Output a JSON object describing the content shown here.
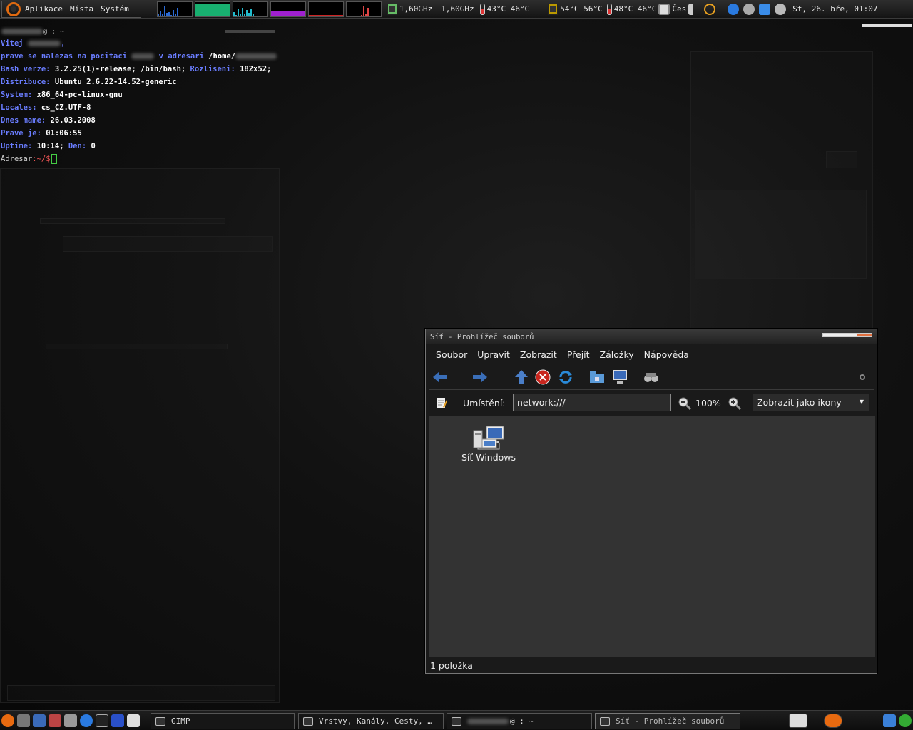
{
  "top_panel": {
    "menus": [
      "Aplikace",
      "Místa",
      "Systém"
    ],
    "cpu1_freq": "1,60GHz",
    "cpu2_freq": "1,60GHz",
    "cpu_temps": "43°C 46°C",
    "hdd_temps": "54°C 56°C",
    "other_temps": "48°C 46°C",
    "keyboard_layout": "Čes",
    "clock": "St, 26. bře, 01:07"
  },
  "terminal": {
    "title": "@ : ~",
    "lines": [
      {
        "label": "Vitej",
        "value": ","
      },
      {
        "label": "prave se nalezas na pocitaci",
        "label2": "v adresari",
        "value": "/home/"
      },
      {
        "label": "Bash verze:",
        "value": "3.2.25(1)-release;",
        "value2": "/bin/bash;",
        "label2": "Rozliseni:",
        "value3": "182x52;"
      },
      {
        "label": "Distribuce:",
        "value": "Ubuntu 2.6.22-14.52-generic"
      },
      {
        "label": "System:",
        "value": "x86_64-pc-linux-gnu"
      },
      {
        "label": "Locales:",
        "value": "cs_CZ.UTF-8"
      },
      {
        "label": "Dnes mame:",
        "value": "26.03.2008"
      },
      {
        "label": "Prave je:",
        "value": "01:06:55"
      },
      {
        "label": "Uptime:",
        "value": "10:14;",
        "label2": "Den:",
        "value2": "0"
      },
      {
        "label": "Adresar",
        "value": ":~/$"
      }
    ]
  },
  "file_browser": {
    "title": "Síť - Prohlížeč souborů",
    "menu": [
      {
        "ul": "S",
        "rest": "oubor"
      },
      {
        "ul": "U",
        "rest": "pravit"
      },
      {
        "ul": "Z",
        "rest": "obrazit"
      },
      {
        "ul": "P",
        "rest": "řejít"
      },
      {
        "ul": "Z",
        "rest": "áložky"
      },
      {
        "ul": "N",
        "rest": "ápověda"
      }
    ],
    "location_label": "Umístění:",
    "location_value": "network:///",
    "zoom_level": "100%",
    "view_mode": "Zobrazit jako ikony",
    "items": [
      {
        "label": "Síť Windows",
        "icon": "network-computers-icon"
      }
    ],
    "status": "1 položka"
  },
  "bottom_panel": {
    "tasks": [
      {
        "label": "GIMP"
      },
      {
        "label": "Vrstvy, Kanály, Cesty, …"
      },
      {
        "label": "@ : ~"
      },
      {
        "label": "Síť - Prohlížeč souborů"
      }
    ]
  },
  "colors": {
    "terminal_label": "#6a7dff",
    "accent_orange": "#e06a10"
  }
}
